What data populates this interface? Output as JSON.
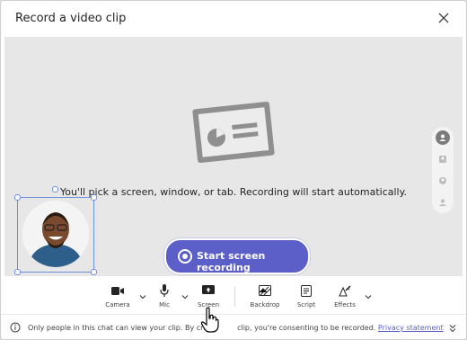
{
  "dialog": {
    "title": "Record a video clip",
    "close_icon": "close-icon"
  },
  "stage": {
    "illustration_icon": "screen-share-illustration",
    "hint": "You'll pick a screen, window, or tab. Recording will start automatically.",
    "rail_icons": [
      "person-icon",
      "contact-card-icon",
      "person-circle-icon",
      "silhouette-icon"
    ],
    "record_button": "Start screen recording",
    "accent": "#5b5fc7"
  },
  "toolbar": {
    "camera": "Camera",
    "mic": "Mic",
    "screen": "Screen",
    "backdrop": "Backdrop",
    "script": "Script",
    "effects": "Effects"
  },
  "footer": {
    "text_start": "Only people in this chat can view your clip. By crea",
    "text_end": "clip, you're consenting to be recorded.",
    "link": "Privacy statement"
  }
}
